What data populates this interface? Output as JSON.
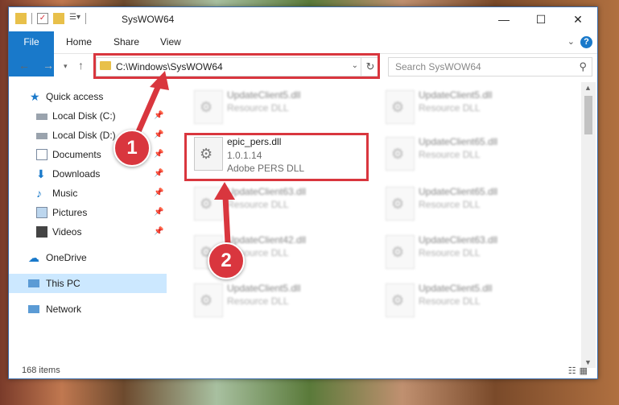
{
  "window": {
    "title": "SysWOW64",
    "minimize": "—",
    "maximize": "☐",
    "close": "✕"
  },
  "ribbon": {
    "tabs": [
      "File",
      "Home",
      "Share",
      "View"
    ],
    "help": "?"
  },
  "address": {
    "path": "C:\\Windows\\SysWOW64",
    "search_placeholder": "Search SysWOW64"
  },
  "nav": {
    "items": [
      {
        "label": "Quick access",
        "icon": "star-icon"
      },
      {
        "label": "Local Disk (C:)",
        "icon": "drive-icon",
        "pinned": true
      },
      {
        "label": "Local Disk (D:)",
        "icon": "drive-icon",
        "pinned": true
      },
      {
        "label": "Documents",
        "icon": "documents-icon",
        "pinned": true
      },
      {
        "label": "Downloads",
        "icon": "download-icon",
        "pinned": true
      },
      {
        "label": "Music",
        "icon": "music-icon",
        "pinned": true
      },
      {
        "label": "Pictures",
        "icon": "pictures-icon",
        "pinned": true
      },
      {
        "label": "Videos",
        "icon": "videos-icon",
        "pinned": true
      },
      {
        "label": "OneDrive",
        "icon": "cloud-icon"
      },
      {
        "label": "This PC",
        "icon": "pc-icon",
        "selected": true
      },
      {
        "label": "Network",
        "icon": "network-icon"
      }
    ]
  },
  "files": [
    {
      "name": "UpdateClient5.dll",
      "type": "Resource DLL",
      "blurred": true
    },
    {
      "name": "UpdateClient5.dll",
      "type": "Resource DLL",
      "blurred": true
    },
    {
      "name": "epic_pers.dll",
      "version": "1.0.1.14",
      "type": "Adobe PERS DLL",
      "blurred": false
    },
    {
      "name": "UpdateClient65.dll",
      "type": "Resource DLL",
      "blurred": true
    },
    {
      "name": "UpdateClient63.dll",
      "type": "Resource DLL",
      "blurred": true
    },
    {
      "name": "UpdateClient65.dll",
      "type": "Resource DLL",
      "blurred": true
    },
    {
      "name": "UpdateClient42.dll",
      "type": "Resource DLL",
      "blurred": true
    },
    {
      "name": "UpdateClient63.dll",
      "type": "Resource DLL",
      "blurred": true
    },
    {
      "name": "UpdateClient5.dll",
      "type": "Resource DLL",
      "blurred": true
    },
    {
      "name": "UpdateClient5.dll",
      "type": "Resource DLL",
      "blurred": true
    }
  ],
  "status": {
    "count": "168 items"
  },
  "markers": [
    "1",
    "2"
  ],
  "colors": {
    "accent": "#1979ca",
    "highlight": "#d9363e",
    "selected": "#cce8ff"
  }
}
